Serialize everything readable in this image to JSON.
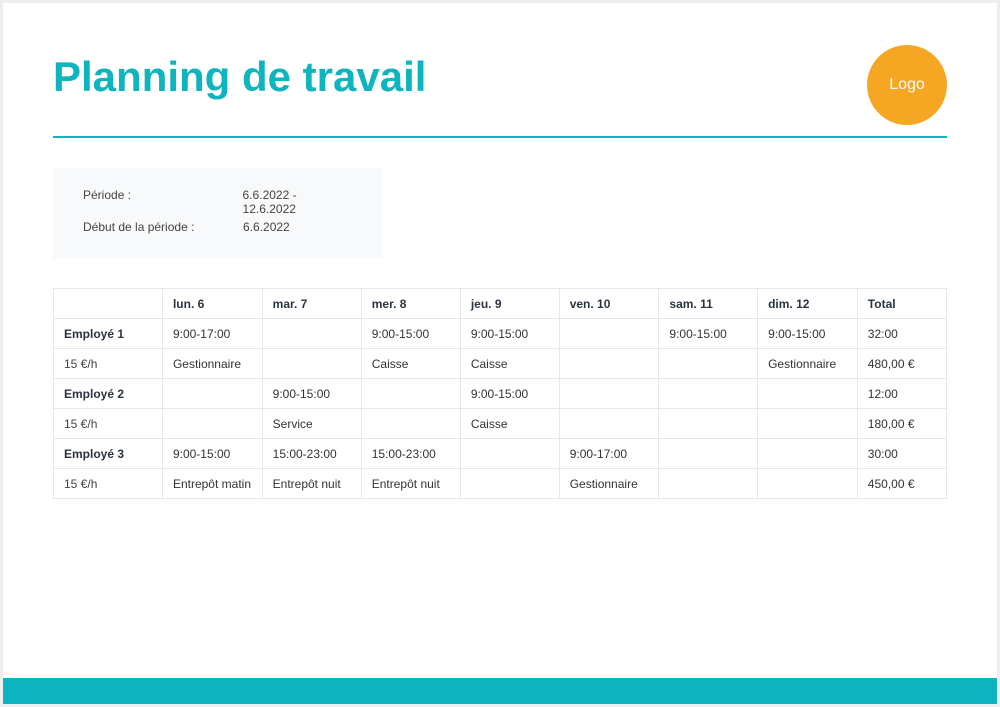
{
  "title": "Planning de travail",
  "logo_text": "Logo",
  "period": {
    "label_period": "Période :",
    "value_period": "6.6.2022  -  12.6.2022",
    "label_start": "Début de la période :",
    "value_start": "6.6.2022"
  },
  "table": {
    "headers": [
      "",
      "lun. 6",
      "mar. 7",
      "mer. 8",
      "jeu. 9",
      "ven. 10",
      "sam. 11",
      "dim. 12",
      "Total"
    ],
    "employees": [
      {
        "name": "Employé 1",
        "rate": "15 €/h",
        "row1": [
          "9:00-17:00",
          "",
          "9:00-15:00",
          "9:00-15:00",
          "",
          "9:00-15:00",
          "9:00-15:00",
          "32:00"
        ],
        "row2": [
          "Gestionnaire",
          "",
          "Caisse",
          "Caisse",
          "",
          "",
          "Gestionnaire",
          "480,00 €"
        ]
      },
      {
        "name": "Employé 2",
        "rate": "15 €/h",
        "row1": [
          "",
          "9:00-15:00",
          "",
          "9:00-15:00",
          "",
          "",
          "",
          "12:00"
        ],
        "row2": [
          "",
          "Service",
          "",
          "Caisse",
          "",
          "",
          "",
          "180,00 €"
        ]
      },
      {
        "name": "Employé 3",
        "rate": "15 €/h",
        "row1": [
          "9:00-15:00",
          "15:00-23:00",
          "15:00-23:00",
          "",
          "9:00-17:00",
          "",
          "",
          "30:00"
        ],
        "row2": [
          "Entrepôt matin",
          "Entrepôt nuit",
          "Entrepôt nuit",
          "",
          "Gestionnaire",
          "",
          "",
          "450,00 €"
        ]
      }
    ]
  }
}
